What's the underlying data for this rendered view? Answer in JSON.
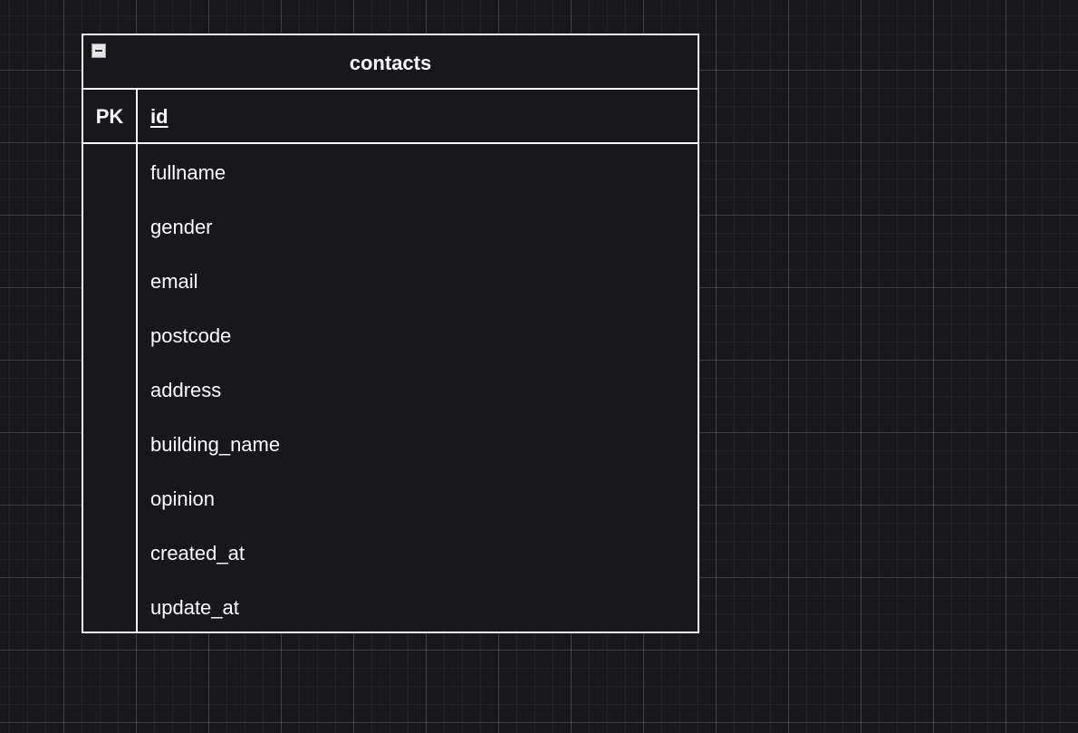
{
  "table": {
    "name": "contacts",
    "primary_key": {
      "key_label": "PK",
      "name": "id"
    },
    "fields": [
      "fullname",
      "gender",
      "email",
      "postcode",
      "address",
      "building_name",
      "opinion",
      "created_at",
      "update_at"
    ]
  },
  "colors": {
    "canvas_background": "#18171c",
    "stroke": "#ffffff",
    "text": "#ffffff"
  },
  "icons": {
    "collapse": "minus-square-icon"
  }
}
